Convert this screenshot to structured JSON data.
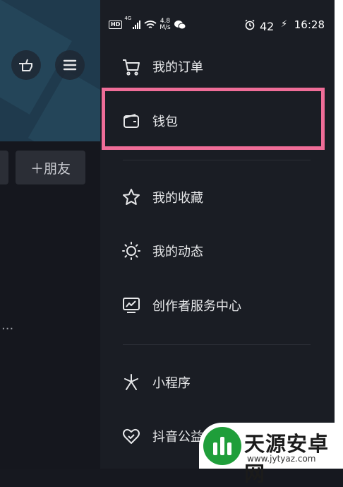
{
  "status_bar": {
    "hd": "HD",
    "network": "4G",
    "speed_value": "4.8",
    "speed_unit": "M/s",
    "battery": "42",
    "time": "16:28"
  },
  "left_panel": {
    "add_friend_label": "＋朋友",
    "ellipsis": "..."
  },
  "drawer": {
    "items": [
      {
        "label": "我的订单",
        "icon": "cart-icon"
      },
      {
        "label": "钱包",
        "icon": "wallet-icon"
      },
      {
        "label": "我的收藏",
        "icon": "star-icon"
      },
      {
        "label": "我的动态",
        "icon": "sun-icon"
      },
      {
        "label": "创作者服务中心",
        "icon": "monitor-chart-icon"
      },
      {
        "label": "小程序",
        "icon": "mini-program-icon"
      },
      {
        "label": "抖音公益",
        "icon": "charity-heart-icon"
      }
    ]
  },
  "watermark": {
    "title": "天源安卓网",
    "url": "www.jytyaz.com"
  },
  "colors": {
    "drawer_bg": "#1a1d24",
    "highlight": "#ef6d98",
    "text": "#e7e8ea"
  }
}
